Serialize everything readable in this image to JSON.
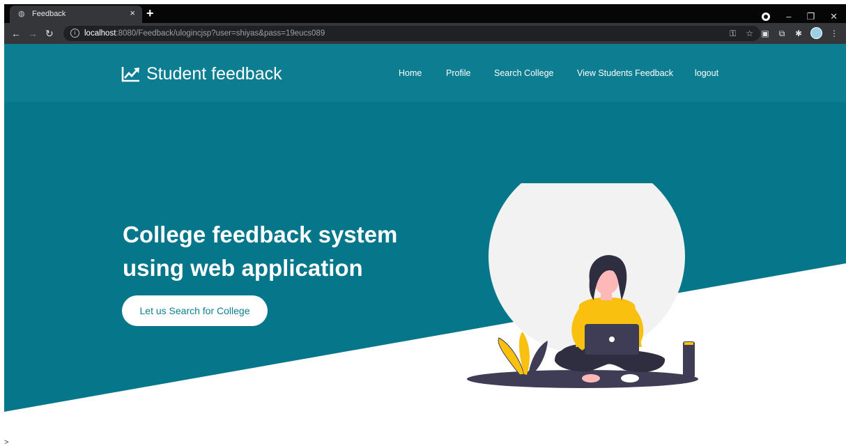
{
  "browser": {
    "tab_title": "Feedback",
    "tab_close": "×",
    "new_tab": "+",
    "url_host": "localhost",
    "url_rest": ":8080/Feedback/ulogincjsp?user=shiyas&pass=19eucs089",
    "window_controls": [
      "–",
      "❐",
      "✕"
    ]
  },
  "site": {
    "brand": "Student feedback",
    "nav": [
      "Home",
      "Profile",
      "Search College",
      "View Students Feedback",
      "logout"
    ]
  },
  "hero": {
    "title": "College feedback system using web application",
    "cta": "Let us Search for College"
  },
  "footer": {
    "caret": ">"
  },
  "colors": {
    "header": "#0d7e92",
    "hero": "#06768a",
    "accent_yellow": "#f9c00f",
    "dark_figure": "#3f3d56"
  }
}
